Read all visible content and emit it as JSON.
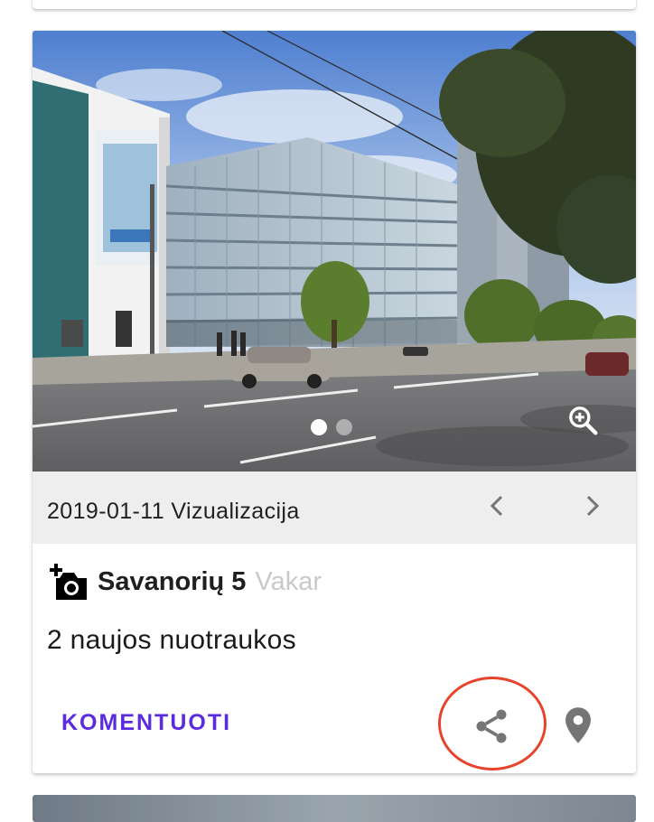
{
  "photo": {
    "alt": "Savanorių 5 vizualizacija",
    "slide_count": 2,
    "active_slide": 1
  },
  "caption": {
    "text": "2019-01-11 Vizualizacija"
  },
  "post": {
    "street": "Savanorių 5",
    "time": "Vakar",
    "description": "2 naujos nuotraukos"
  },
  "actions": {
    "comment_label": "KOMENTUOTI"
  },
  "icons": {
    "zoom": "zoom-in-icon",
    "prev": "chevron-left-icon",
    "next": "chevron-right-icon",
    "camera": "add-photo-icon",
    "share": "share-icon",
    "map": "map-pin-icon"
  },
  "colors": {
    "accent": "#5b2be0",
    "highlight": "#e8432c",
    "caption_bg": "#eeeeee",
    "muted_text": "#c9c9c9"
  }
}
